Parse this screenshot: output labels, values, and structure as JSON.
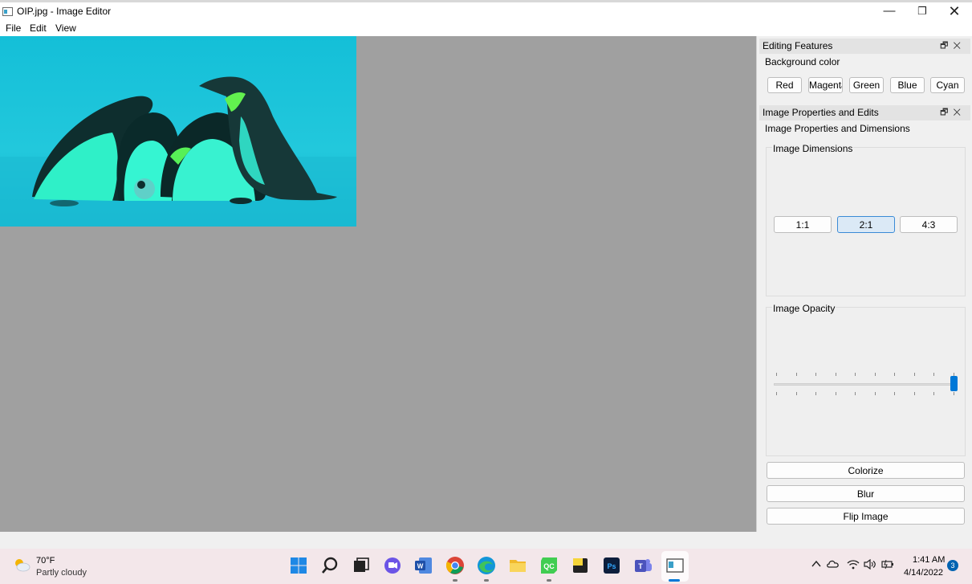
{
  "window": {
    "title": "OIP.jpg - Image Editor",
    "minimize_glyph": "—",
    "maximize_glyph": "❐",
    "close_glyph": "✕"
  },
  "menu": {
    "file": "File",
    "edit": "Edit",
    "view": "View"
  },
  "editing_features": {
    "title": "Editing Features",
    "background_color_label": "Background color",
    "buttons": [
      "Red",
      "Magenta",
      "Green",
      "Blue",
      "Cyan"
    ]
  },
  "image_properties": {
    "title": "Image Properties and Edits",
    "section_label": "Image Properties and Dimensions",
    "dimensions_label": "Image Dimensions",
    "ratios": [
      "1:1",
      "2:1",
      "4:3"
    ],
    "selected_ratio": "2:1",
    "opacity_label": "Image Opacity",
    "opacity_value_fraction": 1.0,
    "actions": {
      "colorize": "Colorize",
      "blur": "Blur",
      "flip": "Flip Image"
    }
  },
  "dock_glyphs": {
    "float": "🗗",
    "close": "✕"
  },
  "taskbar": {
    "weather_temp": "70°F",
    "weather_desc": "Partly cloudy",
    "clock_time": "1:41 AM",
    "clock_date": "4/14/2022",
    "notification_count": "3",
    "apps": [
      "windows-start-icon",
      "search-icon",
      "task-view-icon",
      "chat-icon",
      "word-icon",
      "chrome-icon",
      "edge-icon",
      "file-explorer-icon",
      "qt-creator-icon",
      "sticky-notes-icon",
      "photoshop-icon",
      "teams-icon",
      "image-editor-icon"
    ]
  },
  "colors": {
    "canvas_bg": "#a0a0a0",
    "panel_bg": "#f0f0f0",
    "accent": "#0078d7",
    "photo_ocean": "#19c2d6"
  }
}
